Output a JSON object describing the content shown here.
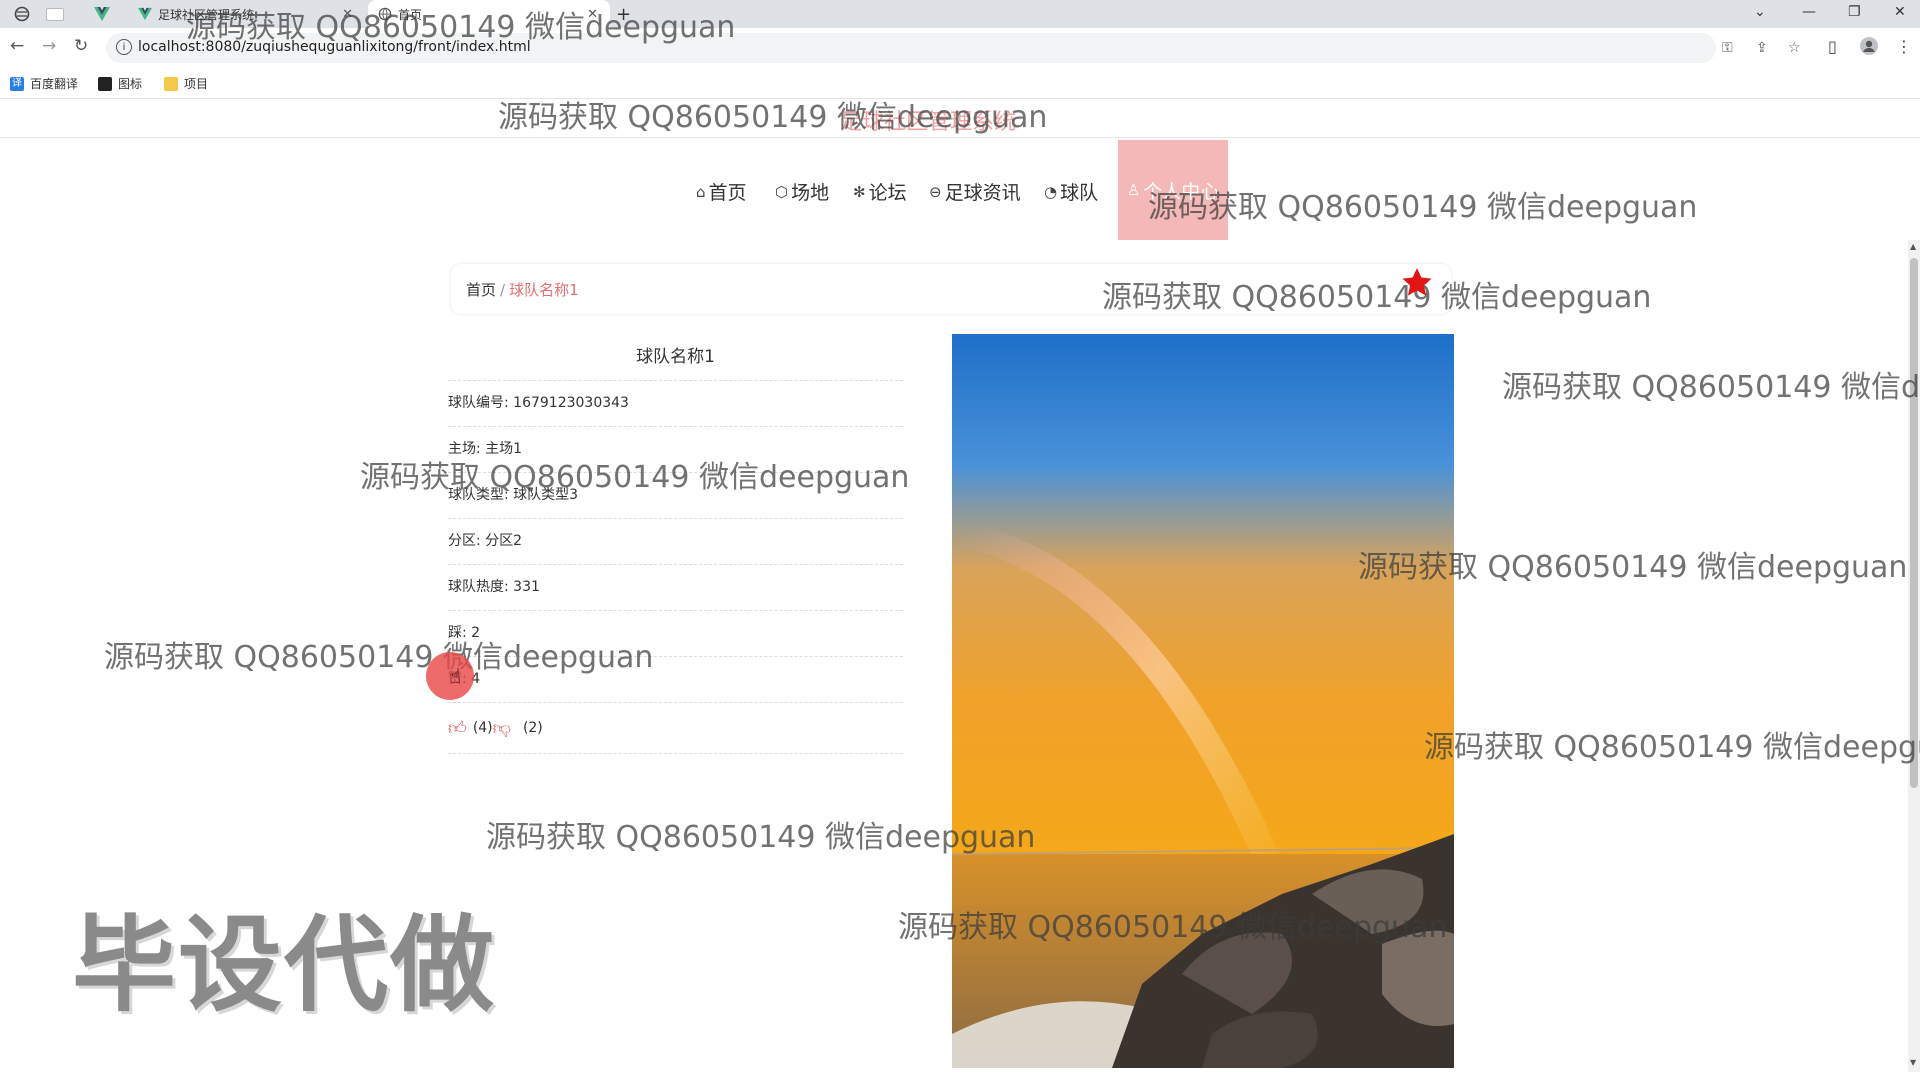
{
  "browser": {
    "tabs": [
      {
        "title": ""
      },
      {
        "title": "足球社区管理系统"
      },
      {
        "title": "首页"
      }
    ],
    "new_tab": "+",
    "url": "localhost:8080/zuqiushequguanlixitong/front/index.html",
    "bookmarks": [
      "百度翻译",
      "图标",
      "项目"
    ]
  },
  "site": {
    "title": "足球社区管理系统",
    "nav": [
      {
        "label": "首页",
        "icon": "home-icon"
      },
      {
        "label": "场地",
        "icon": "cube-icon"
      },
      {
        "label": "论坛",
        "icon": "snowflake-icon"
      },
      {
        "label": "足球资讯",
        "icon": "news-icon"
      },
      {
        "label": "球队",
        "icon": "gauge-icon"
      },
      {
        "label": "个人中心",
        "icon": "user-icon"
      }
    ]
  },
  "breadcrumb": {
    "home": "首页",
    "separator": "/",
    "current": "球队名称1"
  },
  "team": {
    "title": "球队名称1",
    "fields": [
      {
        "label": "球队编号",
        "value": "1679123030343"
      },
      {
        "label": "主场",
        "value": "主场1"
      },
      {
        "label": "球队类型",
        "value": "球队类型3"
      },
      {
        "label": "分区",
        "value": "分区2"
      },
      {
        "label": "球队热度",
        "value": "331"
      },
      {
        "label": "踩",
        "value": "2"
      },
      {
        "label": "赞",
        "value": "4"
      }
    ],
    "likes": "(4)",
    "dislikes": "(2)"
  },
  "watermarks": {
    "text": "源码获取 QQ86050149 微信deepguan",
    "banner": "毕设代做"
  },
  "colors": {
    "accent": "#f4b8b8",
    "breadcrumb_current": "#e07070"
  }
}
